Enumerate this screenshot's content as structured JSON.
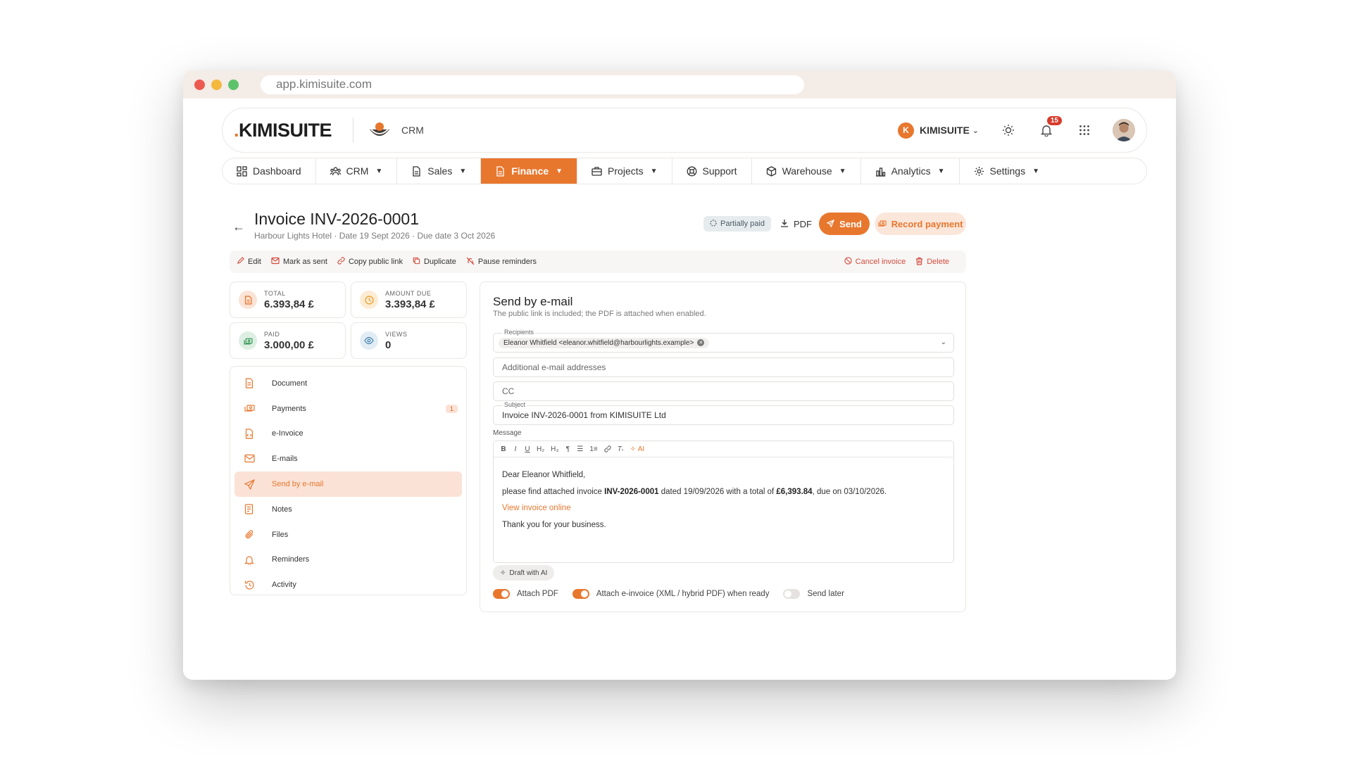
{
  "browser": {
    "url": "app.kimisuite.com"
  },
  "header": {
    "logo": "KIMISUITE",
    "module_label": "CRM",
    "company": "KIMISUITE",
    "company_initial": "K",
    "notification_count": "15"
  },
  "nav": {
    "items": [
      {
        "label": "Dashboard",
        "icon": "dashboard-icon",
        "active": false
      },
      {
        "label": "CRM",
        "icon": "people-icon",
        "active": false
      },
      {
        "label": "Sales",
        "icon": "document-icon",
        "active": false
      },
      {
        "label": "Finance",
        "icon": "document-icon",
        "active": true
      },
      {
        "label": "Projects",
        "icon": "briefcase-icon",
        "active": false
      },
      {
        "label": "Support",
        "icon": "lifebuoy-icon",
        "active": false
      },
      {
        "label": "Warehouse",
        "icon": "box-icon",
        "active": false
      },
      {
        "label": "Analytics",
        "icon": "bar-chart-icon",
        "active": false
      },
      {
        "label": "Settings",
        "icon": "gear-icon",
        "active": false
      }
    ]
  },
  "invoice": {
    "title": "Invoice INV-2026-0001",
    "subtitle": "Harbour Lights Hotel · Date 19 Sept 2026 · Due date 3 Oct 2026",
    "status": "Partially paid",
    "pdf_label": "PDF",
    "send_label": "Send",
    "record_payment_label": "Record payment"
  },
  "actions": {
    "edit": "Edit",
    "mark_sent": "Mark as sent",
    "copy_link": "Copy public link",
    "duplicate": "Duplicate",
    "pause_reminders": "Pause reminders",
    "cancel_invoice": "Cancel invoice",
    "delete": "Delete"
  },
  "stats": {
    "total": {
      "label": "TOTAL",
      "value": "6.393,84 £"
    },
    "amount_due": {
      "label": "AMOUNT DUE",
      "value": "3.393,84 £"
    },
    "paid": {
      "label": "PAID",
      "value": "3.000,00 £"
    },
    "views": {
      "label": "VIEWS",
      "value": "0"
    }
  },
  "side_menu": {
    "items": [
      {
        "label": "Document",
        "icon": "document-icon"
      },
      {
        "label": "Payments",
        "icon": "cash-icon",
        "count": "1"
      },
      {
        "label": "e-Invoice",
        "icon": "e-invoice-icon"
      },
      {
        "label": "E-mails",
        "icon": "mail-icon"
      },
      {
        "label": "Send by e-mail",
        "icon": "send-icon",
        "active": true
      },
      {
        "label": "Notes",
        "icon": "note-icon"
      },
      {
        "label": "Files",
        "icon": "paperclip-icon"
      },
      {
        "label": "Reminders",
        "icon": "bell-icon"
      },
      {
        "label": "Activity",
        "icon": "history-icon"
      }
    ]
  },
  "email": {
    "title": "Send by e-mail",
    "subtitle": "The public link is included; the PDF is attached when enabled.",
    "recipients_label": "Recipients",
    "recipient": "Eleanor Whitfield <eleanor.whitfield@harbourlights.example>",
    "additional_placeholder": "Additional e-mail addresses",
    "cc_placeholder": "CC",
    "subject_label": "Subject",
    "subject": "Invoice INV-2026-0001 from KIMISUITE Ltd",
    "message_label": "Message",
    "toolbar": [
      "B",
      "I",
      "U",
      "H₂",
      "H₃",
      "¶",
      "☰",
      "1≡",
      "🔗",
      "T✕"
    ],
    "toolbar_ai": "AI",
    "body": {
      "greeting": "Dear Eleanor Whitfield,",
      "line_prefix": "please find attached invoice ",
      "invoice_no": "INV-2026-0001",
      "line_mid": " dated 19/09/2026 with a total of ",
      "total": "£6,393.84",
      "line_suffix": ", due on 03/10/2026.",
      "link": "View invoice online",
      "closing": "Thank you for your business."
    },
    "draft_ai": "Draft with AI",
    "toggles": [
      {
        "label": "Attach PDF",
        "on": true
      },
      {
        "label": "Attach e-invoice (XML / hybrid PDF) when ready",
        "on": true
      },
      {
        "label": "Send later",
        "on": false
      }
    ]
  }
}
